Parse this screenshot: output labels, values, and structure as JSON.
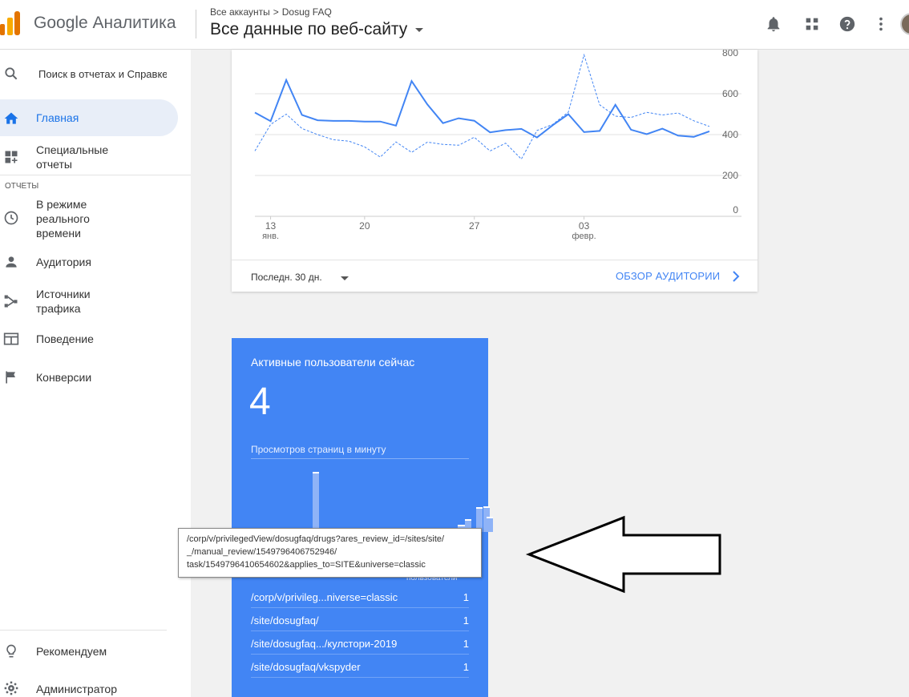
{
  "header": {
    "brand": "Google Аналитика",
    "breadcrumb": [
      "Все аккаунты",
      "Dosug FAQ"
    ],
    "breadcrumb_sep": ">",
    "view_title": "Все данные по веб-сайту",
    "icons": [
      "bell-icon",
      "apps-grid-icon",
      "help-icon",
      "more-vert-icon",
      "avatar"
    ]
  },
  "sidebar": {
    "search_placeholder": "Поиск в отчетах и Справке",
    "items": [
      {
        "label": "Главная",
        "icon": "home-icon",
        "active": true
      },
      {
        "label": "Специальные отчеты",
        "icon": "dashboard-add-icon"
      }
    ],
    "section": "ОТЧЕТЫ",
    "reports": [
      {
        "label": "В режиме реального времени",
        "icon": "clock-icon"
      },
      {
        "label": "Аудитория",
        "icon": "person-icon"
      },
      {
        "label": "Источники трафика",
        "icon": "acquisition-icon"
      },
      {
        "label": "Поведение",
        "icon": "behavior-icon"
      },
      {
        "label": "Конверсии",
        "icon": "flag-icon"
      }
    ],
    "bottom": [
      {
        "label": "Рекомендуем",
        "icon": "lightbulb-icon"
      },
      {
        "label": "Администратор",
        "icon": "gear-icon"
      }
    ]
  },
  "audience_card": {
    "range_label": "Последн. 30 дн.",
    "link": "ОБЗОР АУДИТОРИИ"
  },
  "chart_data": {
    "type": "line",
    "title": "",
    "ylim": [
      0,
      800
    ],
    "y_ticks": [
      "800",
      "600",
      "400",
      "200",
      "0"
    ],
    "x_ticks": [
      {
        "label": "13",
        "sub": "янв."
      },
      {
        "label": "20",
        "sub": ""
      },
      {
        "label": "27",
        "sub": ""
      },
      {
        "label": "03",
        "sub": "февр."
      }
    ],
    "grid": true,
    "series": [
      {
        "style": "solid",
        "color": "#4285f4",
        "values": [
          508,
          466,
          667,
          496,
          470,
          467,
          467,
          464,
          464,
          444,
          662,
          548,
          456,
          480,
          468,
          411,
          422,
          428,
          386,
          446,
          500,
          412,
          418,
          546,
          424,
          402,
          429,
          395,
          389,
          416
        ]
      },
      {
        "style": "dashed",
        "color": "#4285f4",
        "values": [
          320,
          450,
          500,
          430,
          400,
          375,
          368,
          340,
          290,
          364,
          313,
          363,
          352,
          348,
          387,
          320,
          358,
          280,
          420,
          450,
          510,
          790,
          546,
          490,
          484,
          509,
          496,
          506,
          468,
          440
        ]
      }
    ]
  },
  "realtime": {
    "title": "Активные пользователи сейчас",
    "count": "4",
    "pageviews_label": "Просмотров страниц в минуту",
    "bars": [
      0,
      0,
      0,
      0,
      0,
      0,
      0,
      0,
      0,
      0,
      0,
      0,
      0,
      0,
      0,
      0,
      0,
      0,
      0,
      0,
      0,
      0,
      0,
      0,
      0,
      0,
      0,
      0,
      0,
      0,
      0,
      0,
      0,
      0,
      0,
      0,
      0,
      0,
      0,
      0,
      0,
      0,
      0,
      0,
      0,
      0,
      0,
      0,
      0,
      0,
      0,
      0,
      0,
      0,
      0,
      0,
      0,
      0,
      0,
      0
    ],
    "column_header": "пользователи",
    "rows": [
      {
        "page": "/corp/v/privileg...niverse=classic",
        "count": "1"
      },
      {
        "page": "/site/dosugfaq/",
        "count": "1"
      },
      {
        "page": "/site/dosugfaq.../кулстори-2019",
        "count": "1"
      },
      {
        "page": "/site/dosugfaq/vkspyder",
        "count": "1"
      }
    ]
  },
  "tooltip": {
    "lines": [
      "/corp/v/privilegedView/dosugfaq/drugs?ares_review_id=/sites/site/",
      "_/manual_review/1549796406752946/",
      "task/1549796410654602&applies_to=SITE&universe=classic"
    ]
  }
}
